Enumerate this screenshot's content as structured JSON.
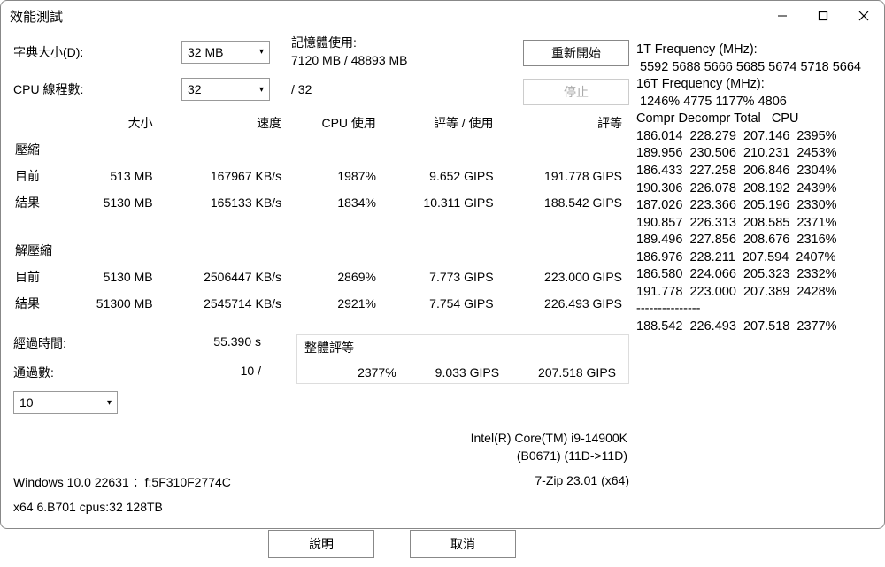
{
  "window": {
    "title": "效能測試"
  },
  "labels": {
    "dict_size": "字典大小(D):",
    "cpu_threads": "CPU 線程數:",
    "mem_usage_title": "記憶體使用:",
    "mem_usage_value": "7120 MB / 48893 MB",
    "thread_total": "/ 32",
    "restart": "重新開始",
    "stop": "停止",
    "elapsed": "經過時間:",
    "passes": "通過數:",
    "overall": "整體評等",
    "help": "說明",
    "cancel": "取消"
  },
  "selects": {
    "dict_size": "32 MB",
    "threads": "32",
    "passes_target": "10"
  },
  "headers": {
    "size": "大小",
    "speed": "速度",
    "cpu_use": "CPU 使用",
    "rating_use": "評等 / 使用",
    "rating": "評等",
    "compress": "壓縮",
    "decompress": "解壓縮",
    "current": "目前",
    "result": "結果"
  },
  "table": {
    "compress_current": {
      "size": "513 MB",
      "speed": "167967 KB/s",
      "cpu": "1987%",
      "ru": "9.652 GIPS",
      "rating": "191.778 GIPS"
    },
    "compress_result": {
      "size": "5130 MB",
      "speed": "165133 KB/s",
      "cpu": "1834%",
      "ru": "10.311 GIPS",
      "rating": "188.542 GIPS"
    },
    "decompress_current": {
      "size": "5130 MB",
      "speed": "2506447 KB/s",
      "cpu": "2869%",
      "ru": "7.773 GIPS",
      "rating": "223.000 GIPS"
    },
    "decompress_result": {
      "size": "51300 MB",
      "speed": "2545714 KB/s",
      "cpu": "2921%",
      "ru": "7.754 GIPS",
      "rating": "226.493 GIPS"
    }
  },
  "elapsed_value": "55.390 s",
  "passes_value": "10 /",
  "totals": {
    "cpu": "2377%",
    "ru": "9.033 GIPS",
    "rating": "207.518 GIPS"
  },
  "cpu_info": {
    "line1": "Intel(R) Core(TM) i9-14900K",
    "line2": "(B0671) (11D->11D)"
  },
  "sys": {
    "os": "Windows 10.0 22631 ：f:5F310F2774C",
    "app": "7-Zip 23.01 (x64)",
    "arch": "x64 6.B701 cpus:32 128TB"
  },
  "right_panel": "1T Frequency (MHz):\n 5592 5688 5666 5685 5674 5718 5664\n16T Frequency (MHz):\n 1246% 4775 1177% 4806\nCompr Decompr Total   CPU\n186.014  228.279  207.146  2395%\n189.956  230.506  210.231  2453%\n186.433  227.258  206.846  2304%\n190.306  226.078  208.192  2439%\n187.026  223.366  205.196  2330%\n190.857  226.313  208.585  2371%\n189.496  227.856  208.676  2316%\n186.976  228.211  207.594  2407%\n186.580  224.066  205.323  2332%\n191.778  223.000  207.389  2428%\n---------------\n188.542  226.493  207.518  2377%"
}
